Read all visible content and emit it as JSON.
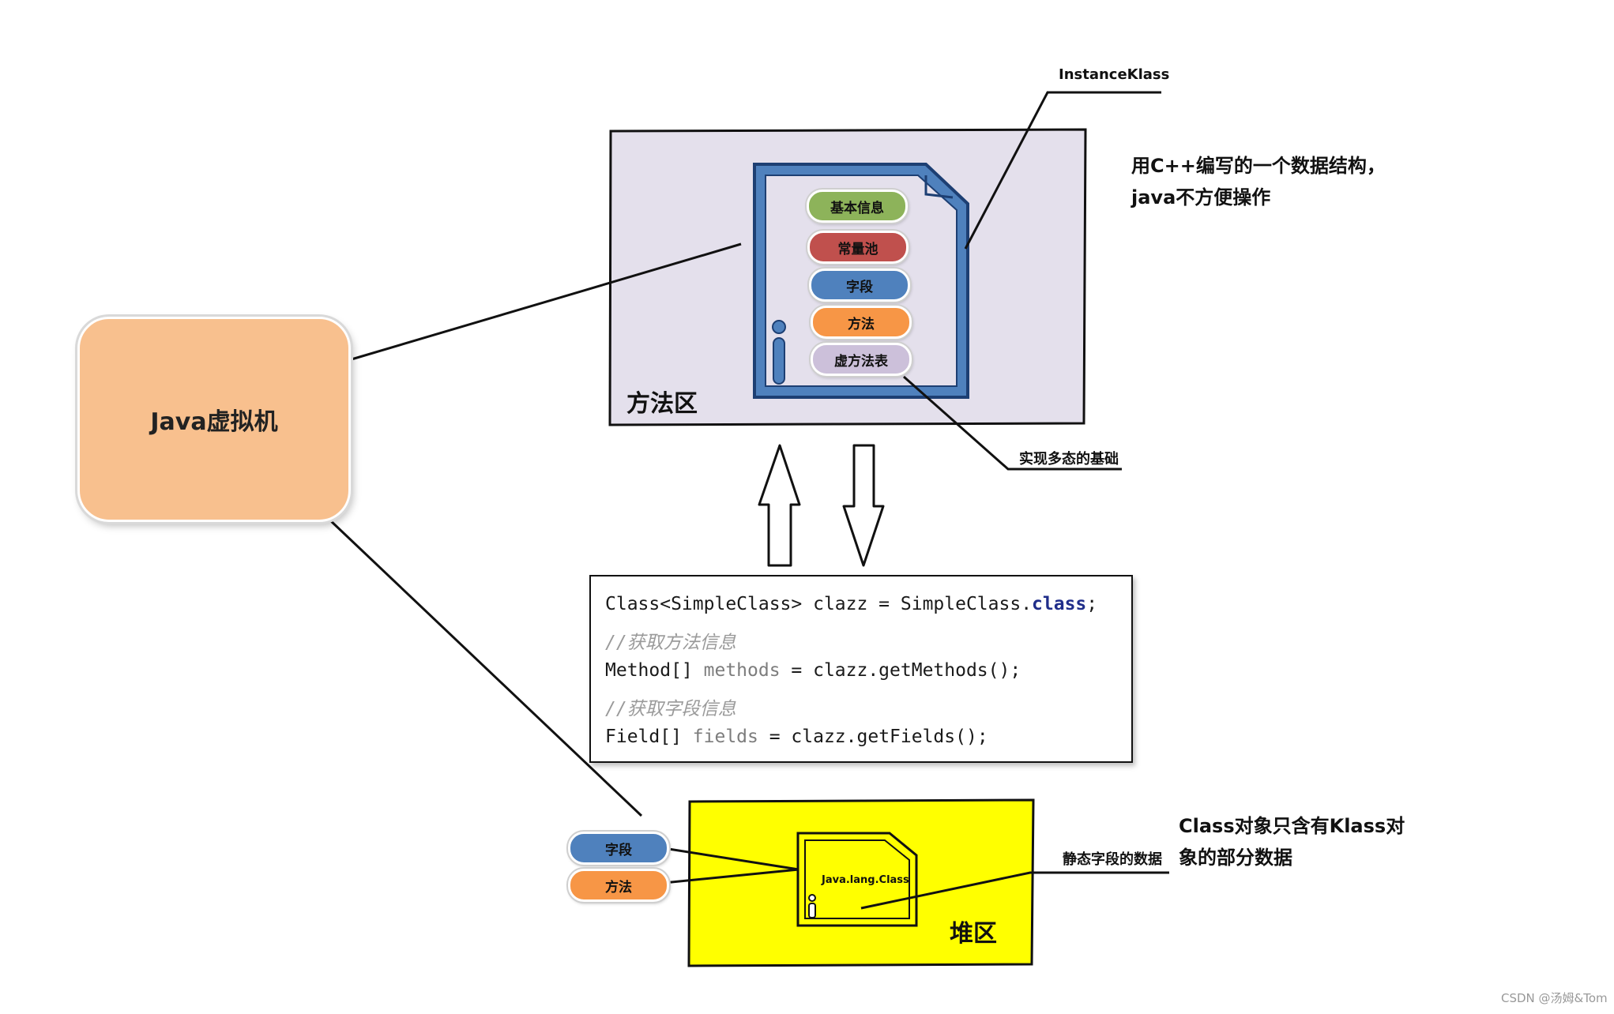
{
  "jvm": {
    "label": "Java虚拟机"
  },
  "method_area": {
    "title": "方法区",
    "klass_label": "InstanceKlass",
    "pills": [
      {
        "label": "基本信息",
        "color": "#8db35a"
      },
      {
        "label": "常量池",
        "color": "#c0504d"
      },
      {
        "label": "字段",
        "color": "#4f81bd"
      },
      {
        "label": "方法",
        "color": "#f79646"
      },
      {
        "label": "虚方法表",
        "color": "#ccc0da"
      }
    ],
    "note_line1": "用C++编写的一个数据结构，",
    "note_line2": "java不方便操作",
    "vtable_note": "实现多态的基础",
    "bg_color": "#e4e0ec",
    "doc_color": "#4f81bd"
  },
  "code": {
    "line1_a": "Class<SimpleClass> clazz = SimpleClass.",
    "line1_kw": "class",
    "line1_b": ";",
    "line2": "//获取方法信息",
    "line3_a": "Method[] ",
    "line3_var": "methods",
    "line3_b": " = clazz.getMethods();",
    "line4": "//获取字段信息",
    "line5_a": "Field[] ",
    "line5_var": "fields",
    "line5_b": " = clazz.getFields();"
  },
  "heap": {
    "title": "堆区",
    "class_label": "Java.lang.Class",
    "pills": [
      {
        "label": "字段",
        "color": "#4f81bd"
      },
      {
        "label": "方法",
        "color": "#f79646"
      }
    ],
    "static_label": "静态字段的数据",
    "note_line1": "Class对象只含有Klass对",
    "note_line2": "象的部分数据",
    "bg_color": "#ffff00"
  },
  "watermark": "CSDN @汤姆&Tom"
}
